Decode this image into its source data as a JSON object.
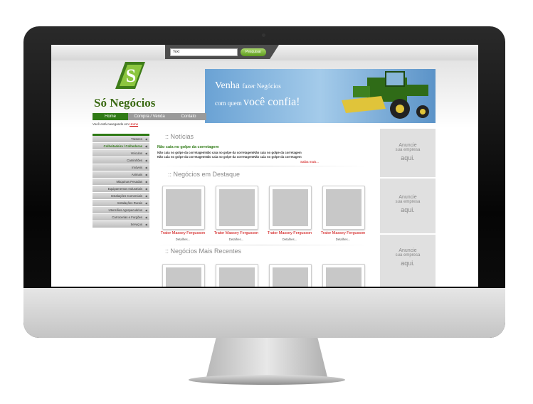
{
  "search": {
    "placeholder": "Text",
    "button_label": "Pesquisar"
  },
  "brand": {
    "name": "Só Negócios"
  },
  "banner": {
    "line1_a": "Venha",
    "line1_b": "fazer Negócios",
    "line2_a": "com quem",
    "line2_b": "você confia!"
  },
  "nav": {
    "items": [
      {
        "label": "Home"
      },
      {
        "label": "Compra / Venda"
      },
      {
        "label": "Contato"
      }
    ]
  },
  "breadcrumb": {
    "prefix": "Você está navegando em",
    "link": "Home"
  },
  "sidebar": {
    "items": [
      {
        "label": "Tratores"
      },
      {
        "label": "Colheitadeira / Colhedoras"
      },
      {
        "label": "Veículos"
      },
      {
        "label": "Caminhões"
      },
      {
        "label": "Imóveis"
      },
      {
        "label": "Animais"
      },
      {
        "label": "Máquinas Pesadas"
      },
      {
        "label": "Equipamentos Industriais"
      },
      {
        "label": "Instalações Comerciais"
      },
      {
        "label": "Instalações Rurais"
      },
      {
        "label": "Utensílios Agropecuários"
      },
      {
        "label": "Carrocerias e Furgões"
      },
      {
        "label": "Serviços"
      }
    ]
  },
  "news": {
    "title": ":: Notícias",
    "headline": "Não caia no golpe da corretagem",
    "lines": [
      "Não caia no golpe da corretagemNão caia no golpe da corretagemNão caia no golpe da corretagem",
      "Não caia no golpe da corretagemNão caia no golpe da corretagemNão caia no golpe da corretagem"
    ],
    "more": "Saiba mais..."
  },
  "featured": {
    "title": ":: Negócios em Destaque",
    "items": [
      {
        "title": "Trator Massey Fergusson",
        "details": "Detalhes..."
      },
      {
        "title": "Trator Massey Fergusson",
        "details": "Detalhes..."
      },
      {
        "title": "Trator Massey Fergusson",
        "details": "Detalhes..."
      },
      {
        "title": "Trator Massey Fergusson",
        "details": "Detalhes..."
      }
    ]
  },
  "recent": {
    "title": ":: Negócios Mais Recentes"
  },
  "ads": [
    {
      "l1": "Anuncie",
      "l2": "sua empresa",
      "l3": "aqui."
    },
    {
      "l1": "Anuncie",
      "l2": "sua empresa",
      "l3": "aqui."
    },
    {
      "l1": "Anuncie",
      "l2": "sua empresa",
      "l3": "aqui."
    }
  ],
  "colors": {
    "brand_green": "#2f7a15",
    "link_red": "#cc0000",
    "banner_blue": "#6aa2d4"
  }
}
